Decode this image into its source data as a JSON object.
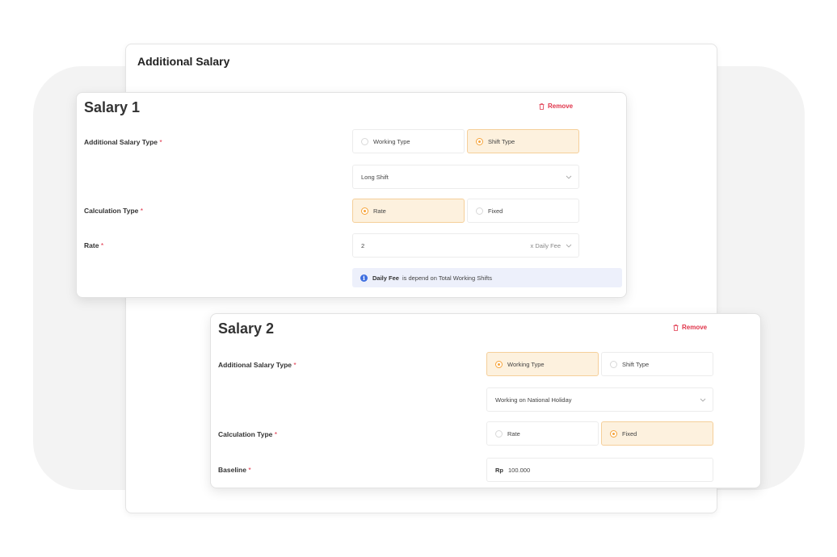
{
  "main": {
    "title": "Additional Salary"
  },
  "salary1": {
    "title": "Salary 1",
    "remove_label": "Remove",
    "additional_type_label": "Additional Salary Type",
    "option_working": "Working Type",
    "option_shift": "Shift Type",
    "selected_type": "Shift Type",
    "type_select_value": "Long Shift",
    "calc_type_label": "Calculation Type",
    "option_rate": "Rate",
    "option_fixed": "Fixed",
    "selected_calc": "Rate",
    "rate_label": "Rate",
    "rate_value": "2",
    "rate_suffix": "x Daily Fee",
    "info_bold": "Daily Fee",
    "info_text": "is depend on Total Working Shifts"
  },
  "salary2": {
    "title": "Salary 2",
    "remove_label": "Remove",
    "additional_type_label": "Additional Salary Type",
    "option_working": "Working Type",
    "option_shift": "Shift Type",
    "selected_type": "Working Type",
    "type_select_value": "Working on National Holiday",
    "calc_type_label": "Calculation Type",
    "option_rate": "Rate",
    "option_fixed": "Fixed",
    "selected_calc": "Fixed",
    "baseline_label": "Baseline",
    "currency": "Rp",
    "baseline_value": "100.000"
  },
  "required_mark": "*",
  "colors": {
    "accent": "#f6a43a",
    "selected_bg": "#fdf1de",
    "danger": "#e0344a",
    "info_bg": "#edf0fb",
    "info_icon": "#3f6fe0"
  }
}
